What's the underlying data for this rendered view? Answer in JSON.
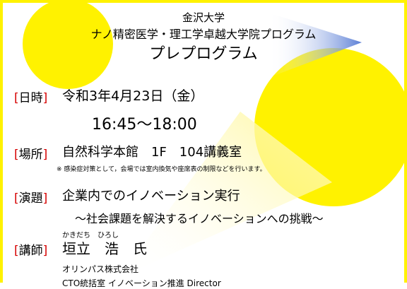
{
  "header": {
    "university": "金沢大学",
    "program": "ナノ精密医学・理工学卓越大学院プログラム",
    "subtitle": "プレプログラム"
  },
  "details": {
    "date": {
      "label": "日時",
      "value": "令和3年4月23日（金）",
      "time": "16:45～18:00"
    },
    "place": {
      "label": "場所",
      "value": "自然科学本館　1F　104講義室",
      "note": "※ 感染症対策として，会場では室内換気や座席表の制限などを行います。"
    },
    "topic": {
      "label": "演題",
      "value": "企業内でのイノベーション実行",
      "sub": "～社会課題を解決するイノベーションへの挑戦～"
    },
    "speaker": {
      "label": "講師",
      "ruby": "かきだち　ひろし",
      "name": "垣立　浩　氏",
      "affiliation": "オリンパス株式会社",
      "role": "CTO統括室 イノベーション推進 Director"
    }
  },
  "colors": {
    "accent": "#fff200",
    "bracket": "#d60000",
    "triangle": "#5b7fd6"
  }
}
